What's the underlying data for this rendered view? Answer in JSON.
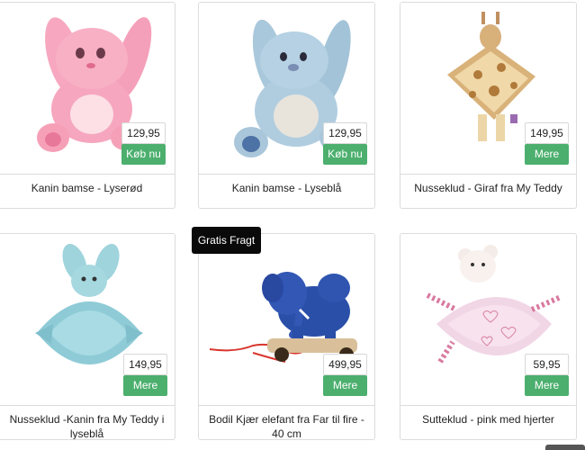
{
  "products": [
    {
      "name": "Kanin bamse - Lyserød",
      "price": "129,95",
      "button": "Køb nu",
      "image_icon": "pink-bunny-plush"
    },
    {
      "name": "Kanin bamse - Lyseblå",
      "price": "129,95",
      "button": "Køb nu",
      "image_icon": "blue-bunny-plush"
    },
    {
      "name": "Nusseklud - Giraf fra My Teddy",
      "price": "149,95",
      "button": "Mere",
      "image_icon": "giraffe-comforter"
    },
    {
      "name": "Nusseklud -Kanin fra My Teddy i lyseblå",
      "price": "149,95",
      "button": "Mere",
      "image_icon": "blue-bunny-comforter"
    },
    {
      "name": "Bodil Kjær elefant fra Far til fire - 40 cm",
      "price": "499,95",
      "button": "Mere",
      "image_icon": "elephant-pull-toy"
    },
    {
      "name": "Sutteklud - pink med hjerter",
      "price": "59,95",
      "button": "Mere",
      "image_icon": "pink-teddy-comforter"
    }
  ],
  "ribbon": "Gratis Fragt",
  "colors": {
    "button": "#4caf6e",
    "ribbon": "#0a0a0a",
    "border": "#dcdcdc"
  }
}
